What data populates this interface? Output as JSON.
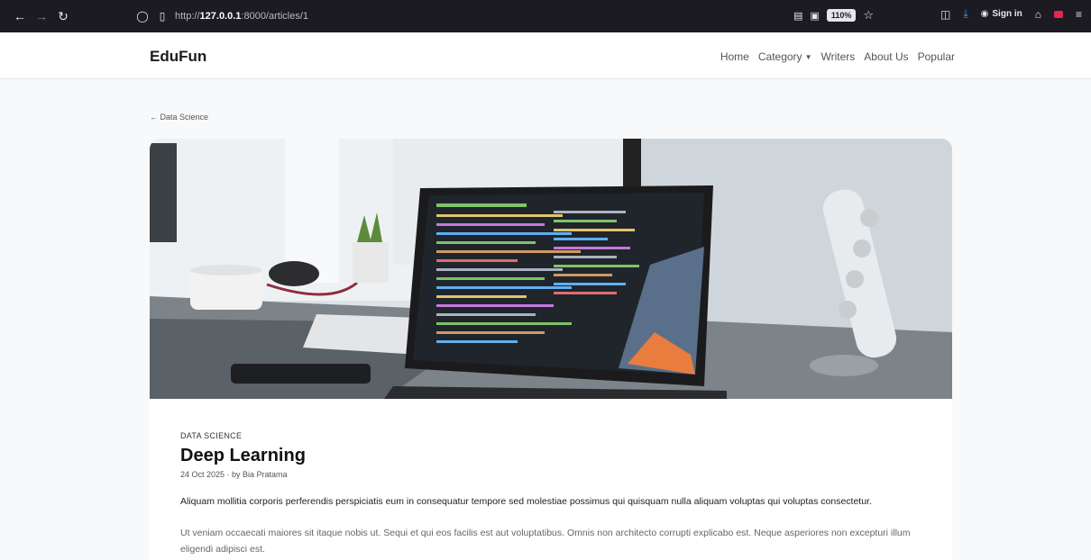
{
  "browser": {
    "url_prefix": "http://",
    "url_host": "127.0.0.1",
    "url_path": ":8000/articles/1",
    "zoom": "110%",
    "signin_label": "Sign in"
  },
  "site": {
    "brand": "EduFun",
    "nav": [
      "Home",
      "Category",
      "Writers",
      "About Us",
      "Popular"
    ]
  },
  "article": {
    "back_link": "← Data Science",
    "category": "DATA SCIENCE",
    "title": "Deep Learning",
    "meta": "24 Oct 2025 · by Bia Pratama",
    "lead": "Aliquam mollitia corporis perferendis perspiciatis eum in consequatur tempore sed molestiae possimus qui quisquam nulla aliquam voluptas qui voluptas consectetur.",
    "body": "Ut veniam occaecati maiores sit itaque nobis ut. Sequi et qui eos facilis est aut voluptatibus. Omnis non architecto corrupti explicabo est. Neque asperiores non excepturi illum eligendi adipisci est."
  }
}
